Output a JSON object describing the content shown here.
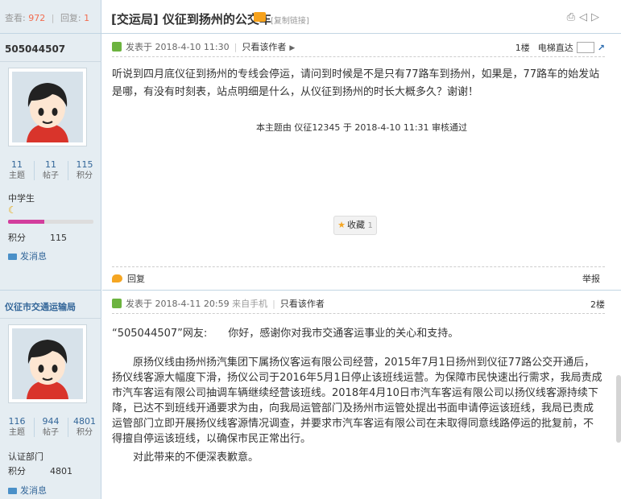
{
  "header": {
    "views_label": "查看:",
    "views_value": "972",
    "replies_label": "回复:",
    "replies_value": "1",
    "thread_title": "[交运局] 仪征到扬州的公交车",
    "copy_link": "[复制链接]",
    "tools_icons": [
      "print-icon",
      "prev-thread-icon",
      "next-thread-icon"
    ]
  },
  "posts": [
    {
      "author": "505044507",
      "stats": [
        {
          "value": "11",
          "label": "主题"
        },
        {
          "value": "11",
          "label": "帖子"
        },
        {
          "value": "115",
          "label": "积分"
        }
      ],
      "rank": "中学生",
      "rank_progress": 0.42,
      "credit_label": "积分",
      "credit_value": "115",
      "message_label": "发消息",
      "meta_posted": "发表于 2018-4-10 11:30",
      "meta_only": "只看该作者",
      "floor": "1楼",
      "jump_label": "电梯直达",
      "body": "听说到四月底仪征到扬州的专线会停运，请问到时候是不是只有77路车到扬州，如果是，77路车的始发站是哪，有没有时刻表，站点明细是什么，从仪征到扬州的时长大概多久？谢谢！",
      "mod_note": "本主题由 仪征12345 于 2018-4-10 11:31 审核通过",
      "fav_label": "收藏",
      "fav_count": "1",
      "reply_label": "回复",
      "report_label": "举报"
    },
    {
      "author": "仪征市交通运输局",
      "stats": [
        {
          "value": "116",
          "label": "主题"
        },
        {
          "value": "944",
          "label": "帖子"
        },
        {
          "value": "4801",
          "label": "积分"
        }
      ],
      "rank": "认证部门",
      "credit_label": "积分",
      "credit_value": "4801",
      "message_label": "发消息",
      "meta_posted": "发表于 2018-4-11 20:59",
      "meta_via": "来自手机",
      "meta_only": "只看该作者",
      "floor": "2楼",
      "salutation": "“505044507”网友:",
      "greeting": "你好，感谢你对我市交通客运事业的关心和支持。",
      "paragraph": "原扬仪线由扬州扬汽集团下属扬仪客运有限公司经营，2015年7月1日扬州到仪征77路公交开通后，扬仪线客源大幅度下滑，扬仪公司于2016年5月1日停止该班线运营。为保障市民快速出行需求，我局责成市汽车客运有限公司抽调车辆继续经营该班线。2018年4月10日市汽车客运有限公司以扬仪线客源持续下降，已达不到班线开通要求为由，向我局运管部门及扬州市运管处提出书面申请停运该班线，我局已责成运管部门立即开展扬仪线客源情况调查，并要求市汽车客运有限公司在未取得同意线路停运的批复前，不得擅自停运该班线，以确保市民正常出行。",
      "closing": "对此带来的不便深表歉意。"
    }
  ],
  "colors": {
    "sidebar_bg": "#e5edf2",
    "border": "#c2d5e3",
    "link_blue": "#336699",
    "accent_red": "#f26c4f",
    "progress_pink": "#d33e9d"
  }
}
